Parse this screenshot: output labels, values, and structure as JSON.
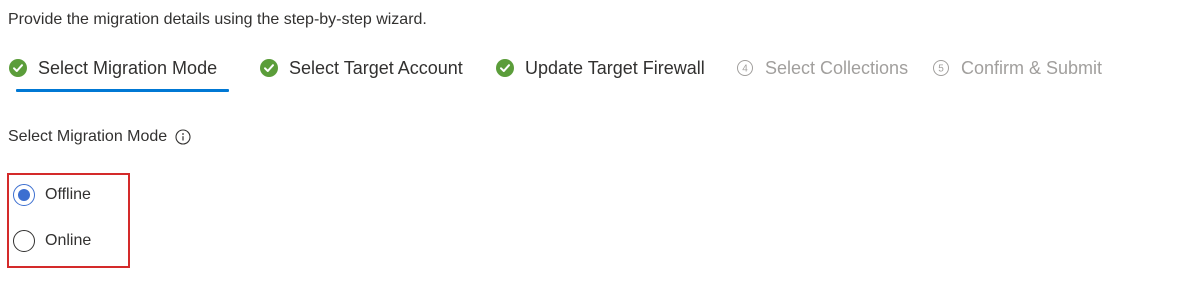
{
  "intro_text": "Provide the migration details using the step-by-step wizard.",
  "steps": [
    {
      "label": "Select Migration Mode",
      "status": "done",
      "active": true
    },
    {
      "label": "Select Target Account",
      "status": "done",
      "active": false
    },
    {
      "label": "Update Target Firewall",
      "status": "done",
      "active": false
    },
    {
      "label": "Select Collections",
      "number": "4",
      "status": "pending",
      "active": false
    },
    {
      "label": "Confirm & Submit",
      "number": "5",
      "status": "pending",
      "active": false
    }
  ],
  "migration_mode": {
    "label": "Select Migration Mode",
    "info_icon": "info-icon",
    "options": [
      {
        "label": "Offline",
        "checked": true
      },
      {
        "label": "Online",
        "checked": false
      }
    ]
  },
  "colors": {
    "check_green": "#5b9d3a",
    "active_underline": "#0078d4",
    "radio_selected": "#3c6fd0",
    "highlight_border": "#d42a2a",
    "pending_text": "#a19f9d"
  }
}
